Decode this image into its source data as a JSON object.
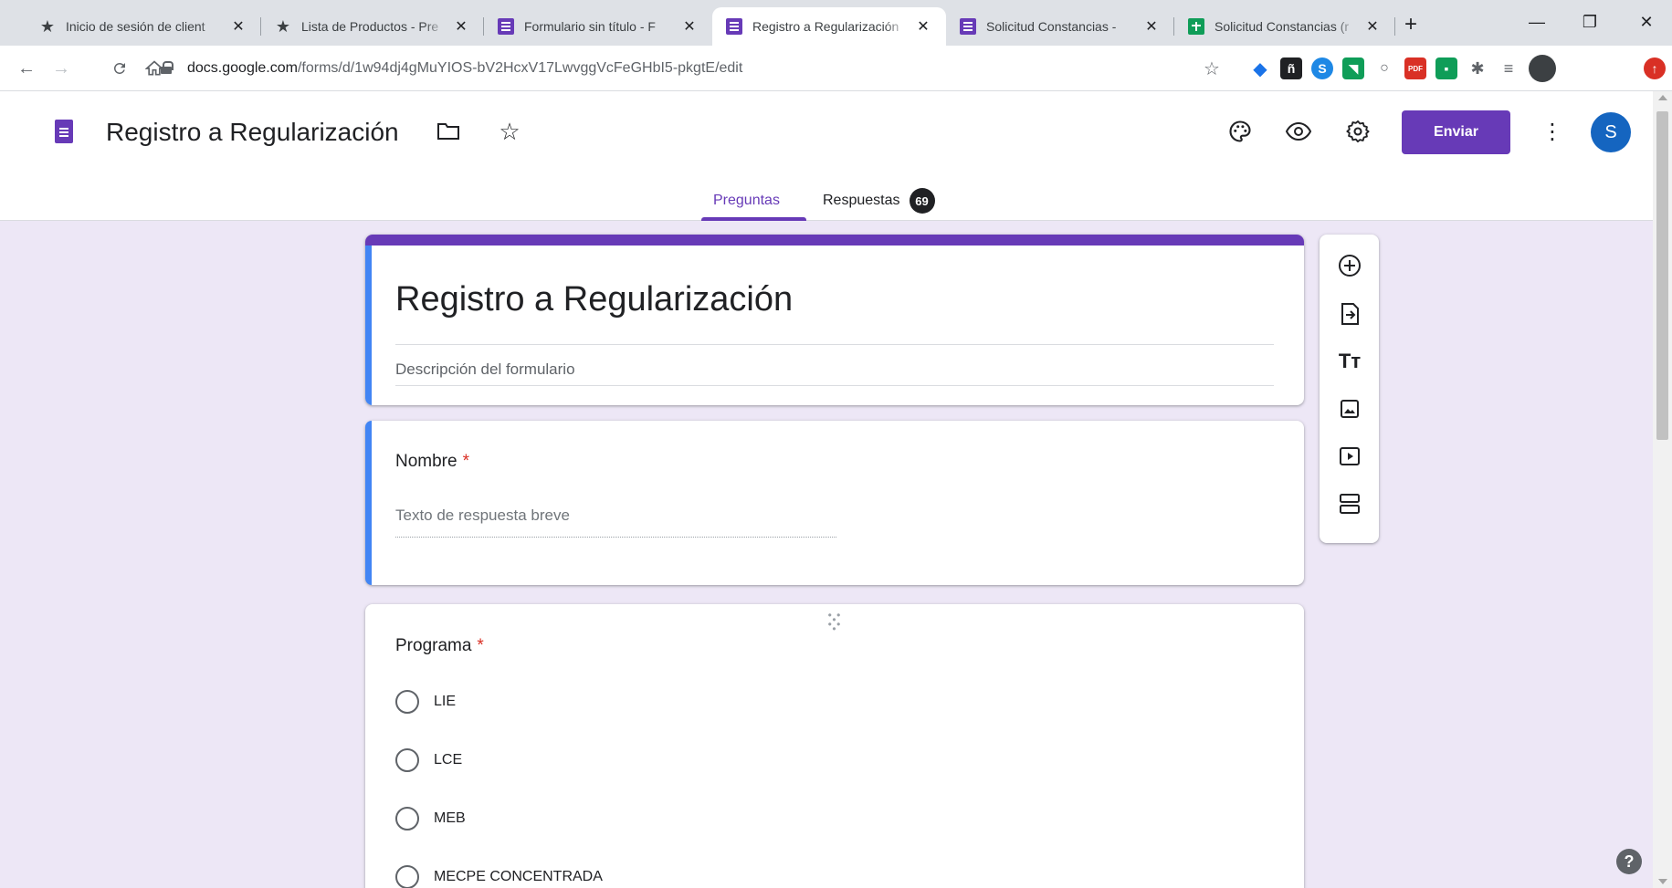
{
  "browser": {
    "tabs": [
      {
        "title": "Inicio de sesión de client",
        "icon": "star-icon"
      },
      {
        "title": "Lista de Productos - Pre",
        "icon": "star-sparkle-icon"
      },
      {
        "title": "Formulario sin título - F",
        "icon": "google-forms-icon"
      },
      {
        "title": "Registro a Regularización",
        "icon": "google-forms-icon",
        "active": true
      },
      {
        "title": "Solicitud Constancias - ",
        "icon": "google-forms-icon"
      },
      {
        "title": "Solicitud Constancias (r",
        "icon": "google-sheets-icon"
      }
    ],
    "url_host": "docs.google.com",
    "url_path": "/forms/d/1w94dj4gMuYIOS-bV2HcxV17LwvggVcFeGHbI5-pkgtE/edit"
  },
  "header": {
    "doc_title": "Registro a Regularización",
    "send_label": "Enviar",
    "avatar_letter": "S",
    "tabs": {
      "questions": "Preguntas",
      "responses": "Respuestas",
      "responses_count": "69"
    }
  },
  "form": {
    "title": "Registro a Regularización",
    "description_placeholder": "Descripción del formulario",
    "questions": [
      {
        "label": "Nombre",
        "required_mark": "*",
        "type": "short_answer",
        "placeholder": "Texto de respuesta breve"
      },
      {
        "label": "Programa",
        "required_mark": "*",
        "type": "multiple_choice",
        "options": [
          "LIE",
          "LCE",
          "MEB",
          "MECPE CONCENTRADA"
        ]
      }
    ]
  },
  "colors": {
    "theme_purple": "#673ab7",
    "active_blue": "#4285f4",
    "canvas_bg": "#ede7f6",
    "required_red": "#d93025"
  },
  "help_label": "?"
}
